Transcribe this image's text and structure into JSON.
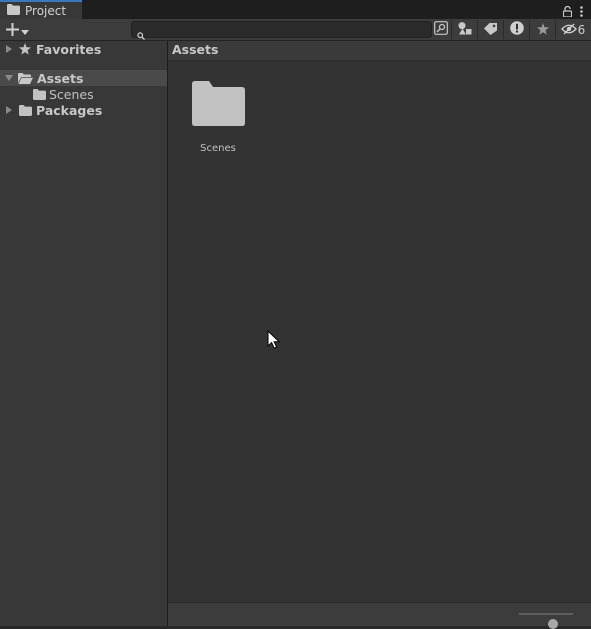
{
  "window": {
    "tab_title": "Project"
  },
  "toolbar": {
    "search_value": "",
    "hidden_packages_count": "6"
  },
  "sidebar": {
    "favorites_label": "Favorites",
    "assets_label": "Assets",
    "scenes_label": "Scenes",
    "packages_label": "Packages"
  },
  "main": {
    "breadcrumb": "Assets",
    "items": [
      {
        "label": "Scenes",
        "type": "folder"
      }
    ]
  },
  "footer": {
    "zoom_level": 0.65
  },
  "colors": {
    "tab_accent": "#3a79bb",
    "selection": "#4a4a4a",
    "folder_icon": "#c2c2c2"
  }
}
